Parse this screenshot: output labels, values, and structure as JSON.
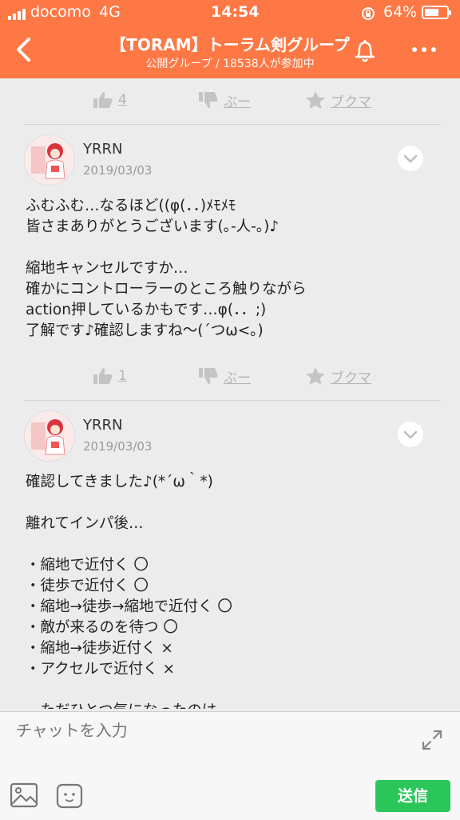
{
  "status": {
    "carrier": "docomo",
    "network": "4G",
    "time": "14:54",
    "battery": "64%",
    "battery_level": 0.64
  },
  "header": {
    "title": "【TORAM】トーラム剣グループ",
    "subtitle": "公開グループ / 18538人が参加中"
  },
  "top_actions": {
    "like_count": "4",
    "boo_label": "ぶー",
    "bookmark_label": "ブクマ"
  },
  "posts": [
    {
      "username": "YRRN",
      "date": "2019/03/03",
      "text": "ふむふむ…なるほど((φ(．．)ﾒﾓﾒﾓ\n皆さまありがとうございます(｡-人-｡)♪\n\n縮地キャンセルですか…\n確かにコントローラーのところ触りながら\naction押しているかもです…φ(．．;)\n了解です♪確認しますね〜(´つω<｡)",
      "like_count": "1",
      "boo_label": "ぶー",
      "bookmark_label": "ブクマ"
    },
    {
      "username": "YRRN",
      "date": "2019/03/03",
      "text": "確認してきました♪(*´ω｀*)\n\n離れてインパ後…\n\n・縮地で近付く 〇\n・徒歩で近付く 〇\n・縮地→徒歩→縮地で近付く 〇\n・敵が来るのを待つ 〇\n・縮地→徒歩近付く ×\n・アクセルで近付く ×\n\n　ただひとつ気になったのは"
    }
  ],
  "composer": {
    "placeholder": "チャットを入力",
    "send_label": "送信"
  },
  "colors": {
    "accent": "#fd7845",
    "send": "#2bc65a"
  }
}
